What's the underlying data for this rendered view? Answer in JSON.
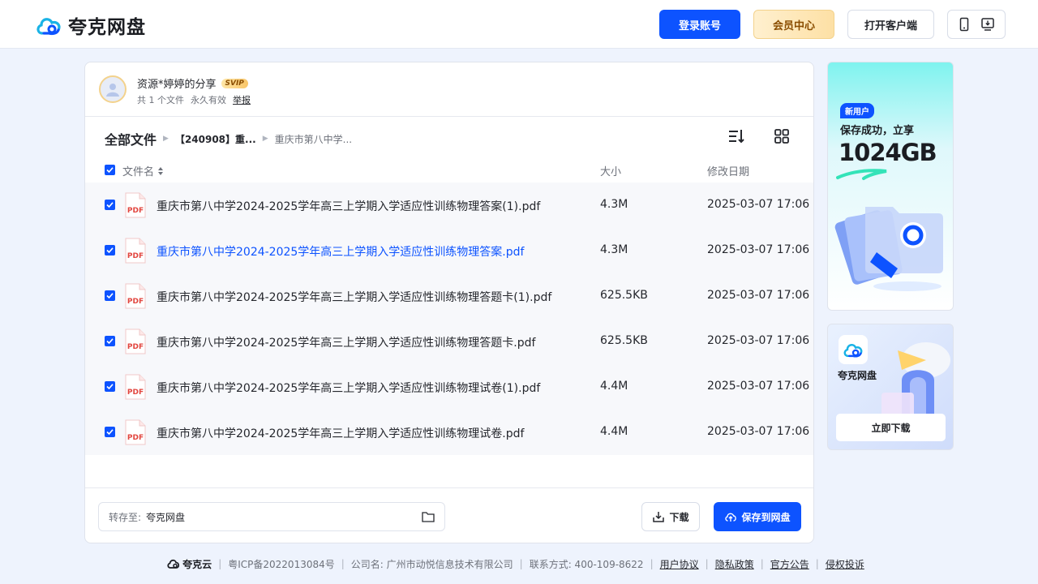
{
  "header": {
    "logo_text": "夸克网盘",
    "login_label": "登录账号",
    "vip_label": "会员中心",
    "client_label": "打开客户端"
  },
  "share": {
    "title": "资源*婷婷的分享",
    "badge": "SVIP",
    "file_count": "共 1 个文件",
    "validity": "永久有效",
    "report": "举报"
  },
  "breadcrumb": {
    "root": "全部文件",
    "level1": "【240908】重...",
    "level2": "重庆市第八中学..."
  },
  "columns": {
    "name": "文件名",
    "size": "大小",
    "date": "修改日期"
  },
  "files": [
    {
      "name": "重庆市第八中学2024-2025学年高三上学期入学适应性训练物理答案(1).pdf",
      "size": "4.3M",
      "date": "2025-03-07 17:06",
      "icon": "pdf-icon",
      "checked": true
    },
    {
      "name": "重庆市第八中学2024-2025学年高三上学期入学适应性训练物理答案.pdf",
      "size": "4.3M",
      "date": "2025-03-07 17:06",
      "icon": "pdf-icon",
      "checked": true
    },
    {
      "name": "重庆市第八中学2024-2025学年高三上学期入学适应性训练物理答题卡(1).pdf",
      "size": "625.5KB",
      "date": "2025-03-07 17:06",
      "icon": "pdf-icon",
      "checked": true
    },
    {
      "name": "重庆市第八中学2024-2025学年高三上学期入学适应性训练物理答题卡.pdf",
      "size": "625.5KB",
      "date": "2025-03-07 17:06",
      "icon": "pdf-icon",
      "checked": true
    },
    {
      "name": "重庆市第八中学2024-2025学年高三上学期入学适应性训练物理试卷(1).pdf",
      "size": "4.4M",
      "date": "2025-03-07 17:06",
      "icon": "pdf-icon",
      "checked": true
    },
    {
      "name": "重庆市第八中学2024-2025学年高三上学期入学适应性训练物理试卷.pdf",
      "size": "4.4M",
      "date": "2025-03-07 17:06",
      "icon": "pdf-icon",
      "checked": true
    }
  ],
  "save_bar": {
    "dest_label": "转存至:",
    "dest_value": "夸克网盘",
    "download_label": "下载",
    "save_label": "保存到网盘"
  },
  "ads": {
    "promo_tag": "新用户",
    "promo_line": "保存成功，立享",
    "promo_big": "1024GB",
    "app_name": "夸克网盘",
    "app_button": "立即下载"
  },
  "footer": {
    "brand": "夸克云",
    "icp": "粤ICP备2022013084号",
    "company": "公司名: 广州市动悦信息技术有限公司",
    "contact": "联系方式: 400-109-8622",
    "links": [
      "用户协议",
      "隐私政策",
      "官方公告",
      "侵权投诉"
    ]
  },
  "colors": {
    "accent": "#0d53ff",
    "vip_gold": "#fde0a5",
    "page_bg": "#eef3fd"
  }
}
